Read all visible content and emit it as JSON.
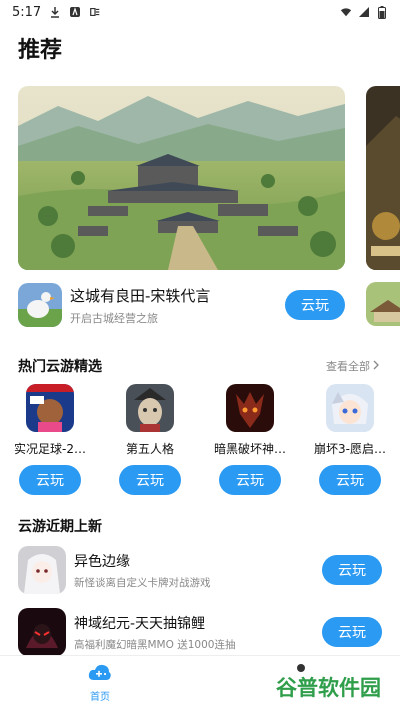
{
  "status_bar": {
    "time": "5:17"
  },
  "page": {
    "title": "推荐"
  },
  "featured": {
    "name": "这城有良田-宋轶代言",
    "desc": "开启古城经营之旅",
    "play_label": "云玩"
  },
  "hot_section": {
    "title": "热门云游精选",
    "more_label": "查看全部",
    "items": [
      {
        "name": "实况足球-2…",
        "play_label": "云玩"
      },
      {
        "name": "第五人格",
        "play_label": "云玩"
      },
      {
        "name": "暗黑破坏神…",
        "play_label": "云玩"
      },
      {
        "name": "崩坏3-愿启…",
        "play_label": "云玩"
      }
    ]
  },
  "recent_section": {
    "title": "云游近期上新",
    "items": [
      {
        "name": "异色边缘",
        "desc": "新怪谈离自定义卡牌对战游戏",
        "play_label": "云玩"
      },
      {
        "name": "神域纪元-天天抽锦鲤",
        "desc": "高福利魔幻暗黑MMO 送1000连抽",
        "play_label": "云玩"
      }
    ]
  },
  "bottom_nav": {
    "home_label": "首页"
  },
  "watermark": {
    "text": "谷普软件园"
  },
  "colors": {
    "accent": "#2b9af3",
    "watermark": "#2f9e4a"
  }
}
